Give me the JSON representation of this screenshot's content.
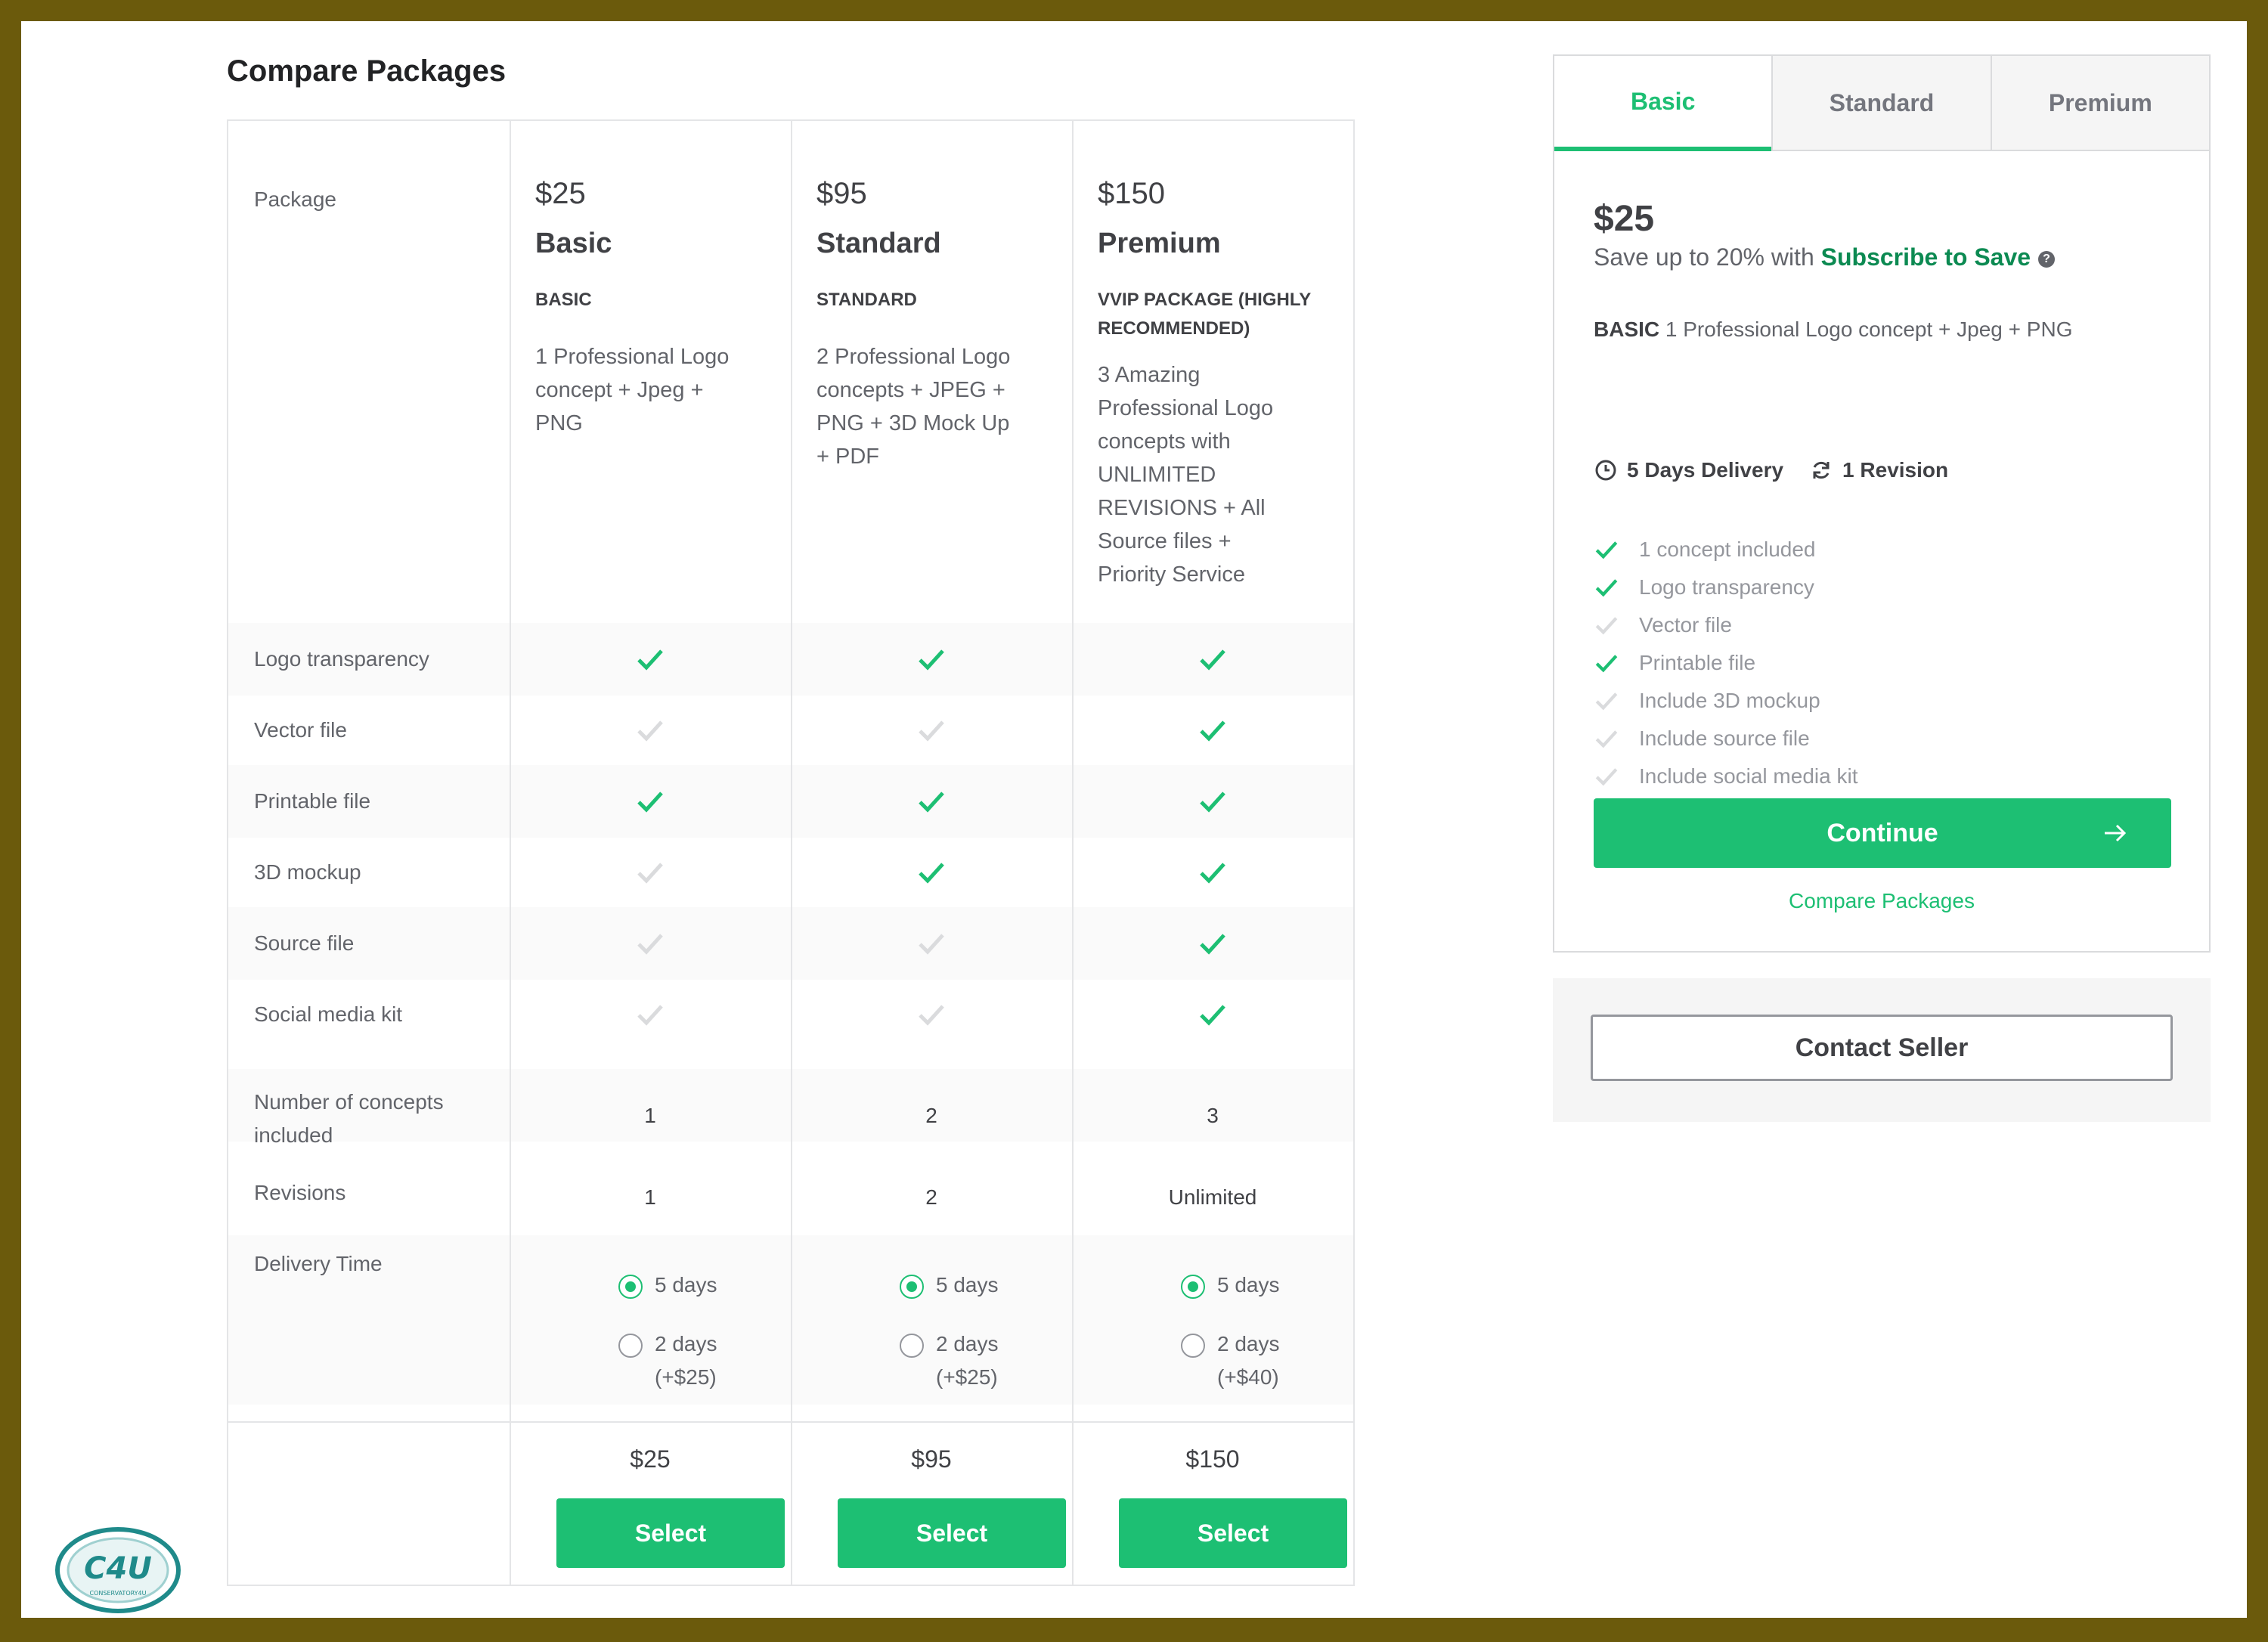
{
  "page": {
    "title": "Compare Packages"
  },
  "compare": {
    "package_label": "Package",
    "packages": [
      {
        "price": "$25",
        "name": "Basic",
        "tag": "BASIC",
        "desc_lines": [
          "1 Professional Logo",
          "concept + Jpeg +",
          "PNG"
        ],
        "footer_price": "$25",
        "select_label": "Select",
        "delivery": [
          {
            "label": "5 days",
            "extra": "",
            "selected": true
          },
          {
            "label": "2 days",
            "extra": "(+$25)",
            "selected": false
          }
        ]
      },
      {
        "price": "$95",
        "name": "Standard",
        "tag": "STANDARD",
        "desc_lines": [
          "2 Professional Logo",
          "concepts + JPEG +",
          "PNG + 3D Mock Up",
          "+ PDF"
        ],
        "footer_price": "$95",
        "select_label": "Select",
        "delivery": [
          {
            "label": "5 days",
            "extra": "",
            "selected": true
          },
          {
            "label": "2 days",
            "extra": "(+$25)",
            "selected": false
          }
        ]
      },
      {
        "price": "$150",
        "name": "Premium",
        "tag_lines": [
          "VVIP PACKAGE (HIGHLY",
          "RECOMMENDED)"
        ],
        "desc_lines": [
          "3 Amazing",
          "Professional Logo",
          "concepts with",
          "UNLIMITED",
          "REVISIONS + All",
          "Source files +",
          "Priority Service"
        ],
        "footer_price": "$150",
        "select_label": "Select",
        "delivery": [
          {
            "label": "5 days",
            "extra": "",
            "selected": true
          },
          {
            "label": "2 days",
            "extra": "(+$40)",
            "selected": false
          }
        ]
      }
    ],
    "feature_rows": [
      {
        "label": "Logo transparency",
        "included": [
          true,
          true,
          true
        ]
      },
      {
        "label": "Vector file",
        "included": [
          false,
          false,
          true
        ]
      },
      {
        "label": "Printable file",
        "included": [
          true,
          true,
          true
        ]
      },
      {
        "label": "3D mockup",
        "included": [
          false,
          true,
          true
        ]
      },
      {
        "label": "Source file",
        "included": [
          false,
          false,
          true
        ]
      },
      {
        "label": "Social media kit",
        "included": [
          false,
          false,
          true
        ]
      }
    ],
    "concepts_label_lines": [
      "Number of concepts",
      "included"
    ],
    "concepts_values": [
      "1",
      "2",
      "3"
    ],
    "revisions_label": "Revisions",
    "revisions_values": [
      "1",
      "2",
      "Unlimited"
    ],
    "delivery_label": "Delivery Time"
  },
  "sidebar": {
    "tabs": [
      "Basic",
      "Standard",
      "Premium"
    ],
    "active_tab": 0,
    "price": "$25",
    "save_text": "Save up to 20% with ",
    "subscribe_link": "Subscribe to Save",
    "help_icon": "?",
    "desc_tag": "BASIC",
    "desc_text": " 1 Professional Logo concept + Jpeg + PNG",
    "delivery": "5 Days Delivery",
    "revision": "1 Revision",
    "features": [
      {
        "label": "1 concept included",
        "included": true
      },
      {
        "label": "Logo transparency",
        "included": true
      },
      {
        "label": "Vector file",
        "included": false
      },
      {
        "label": "Printable file",
        "included": true
      },
      {
        "label": "Include 3D mockup",
        "included": false
      },
      {
        "label": "Include source file",
        "included": false
      },
      {
        "label": "Include social media kit",
        "included": false
      }
    ],
    "continue_label": "Continue",
    "compare_link": "Compare Packages",
    "contact_label": "Contact Seller"
  },
  "watermark": {
    "text": "C4U",
    "subtext": "CONSERVATORY4U"
  },
  "colors": {
    "accent": "#1dbf73",
    "muted_check": "#dadbdd",
    "border": "#6b5a0c"
  }
}
